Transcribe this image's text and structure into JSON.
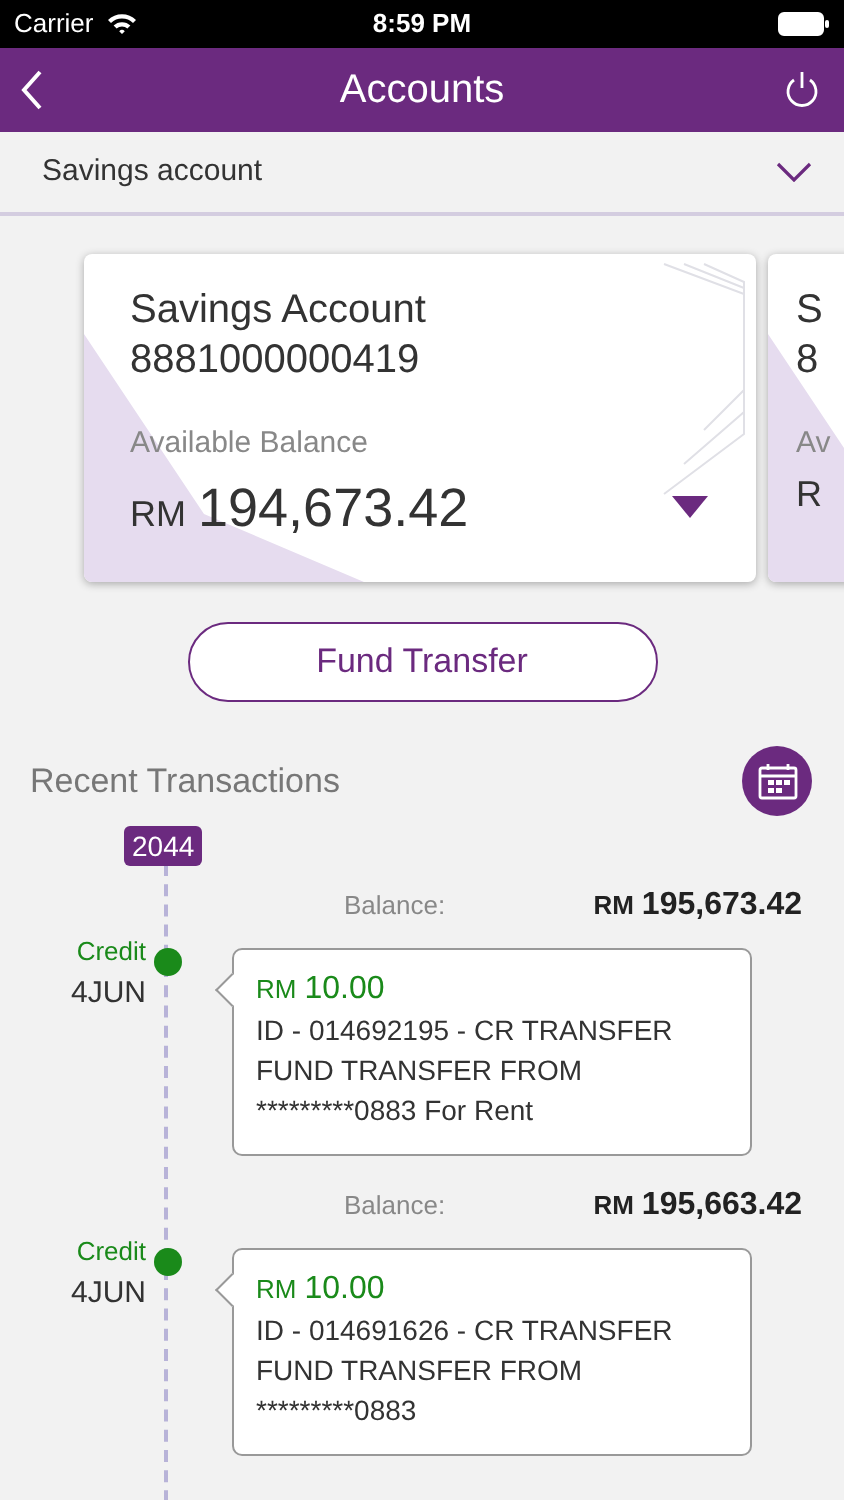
{
  "status_bar": {
    "carrier": "Carrier",
    "time": "8:59 PM"
  },
  "header": {
    "title": "Accounts"
  },
  "account_selector": {
    "value": "Savings account"
  },
  "cards": [
    {
      "name": "Savings Account",
      "number": "8881000000419",
      "balance_label": "Available Balance",
      "currency": "RM",
      "balance": "194,673.42"
    },
    {
      "name": "S",
      "number": "8",
      "balance_label": "Av",
      "currency": "R"
    }
  ],
  "fund_transfer_button": "Fund Transfer",
  "recent_transactions": {
    "title": "Recent Transactions",
    "year": "2044",
    "items": [
      {
        "balance_label": "Balance:",
        "balance_currency": "RM",
        "balance": "195,673.42",
        "kind": "credit",
        "type_label": "Credit",
        "date": "4JUN",
        "amount_currency": "RM",
        "amount": "10.00",
        "description": "ID - 014692195 - CR TRANSFER FUND TRANSFER FROM *********0883 For Rent"
      },
      {
        "balance_label": "Balance:",
        "balance_currency": "RM",
        "balance": "195,663.42",
        "kind": "credit",
        "type_label": "Credit",
        "date": "4JUN",
        "amount_currency": "RM",
        "amount": "10.00",
        "description": "ID - 014691626 - CR TRANSFER FUND TRANSFER FROM *********0883"
      }
    ]
  }
}
